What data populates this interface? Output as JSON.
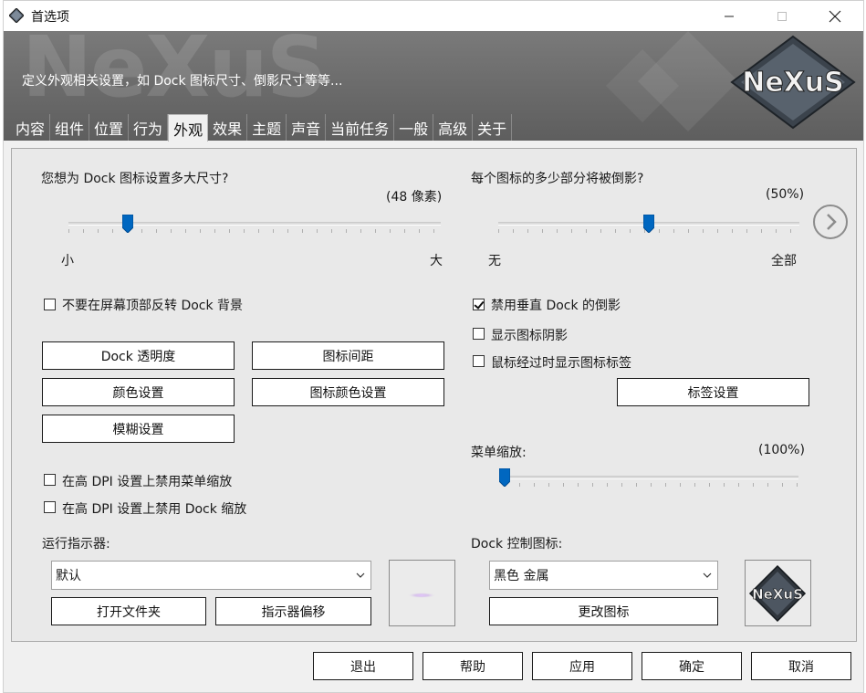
{
  "window": {
    "title": "首选项",
    "controls": {
      "minimize": "minimize",
      "maximize": "maximize",
      "close": "close"
    }
  },
  "banner": {
    "description": "定义外观相关设置，如 Dock 图标尺寸、倒影尺寸等等...",
    "logo_text": "NeXuS"
  },
  "tabs": [
    {
      "label": "内容",
      "active": false
    },
    {
      "label": "组件",
      "active": false
    },
    {
      "label": "位置",
      "active": false
    },
    {
      "label": "行为",
      "active": false
    },
    {
      "label": "外观",
      "active": true
    },
    {
      "label": "效果",
      "active": false
    },
    {
      "label": "主题",
      "active": false
    },
    {
      "label": "声音",
      "active": false
    },
    {
      "label": "当前任务",
      "active": false
    },
    {
      "label": "一般",
      "active": false
    },
    {
      "label": "高级",
      "active": false
    },
    {
      "label": "关于",
      "active": false
    }
  ],
  "icon_size": {
    "question": "您想为 Dock 图标设置多大尺寸?",
    "value_text": "(48 像素)",
    "slider_fraction": 0.16,
    "min_label": "小",
    "max_label": "大"
  },
  "reflection": {
    "question": "每个图标的多少部分将被倒影?",
    "value_text": "(50%)",
    "slider_fraction": 0.5,
    "min_label": "无",
    "max_label": "全部"
  },
  "left_checkbox": {
    "label": "不要在屏幕顶部反转 Dock 背景",
    "checked": false
  },
  "right_checkboxes": [
    {
      "label": "禁用垂直 Dock 的倒影",
      "checked": true
    },
    {
      "label": "显示图标阴影",
      "checked": false
    },
    {
      "label": "鼠标经过时显示图标标签",
      "checked": false
    }
  ],
  "buttons": {
    "dock_opacity": "Dock 透明度",
    "icon_spacing": "图标间距",
    "color_settings": "颜色设置",
    "icon_color_settings": "图标颜色设置",
    "blur_settings": "模糊设置",
    "label_settings": "标签设置",
    "open_folder": "打开文件夹",
    "indicator_offset": "指示器偏移",
    "change_icon": "更改图标"
  },
  "menu_zoom": {
    "label": "菜单缩放:",
    "value_text": "(100%)",
    "slider_fraction": 0.0
  },
  "dpi_checkboxes": [
    {
      "label": "在高 DPI 设置上禁用菜单缩放",
      "checked": false
    },
    {
      "label": "在高 DPI 设置上禁用 Dock 缩放",
      "checked": false
    }
  ],
  "run_indicator": {
    "label": "运行指示器:",
    "selected": "默认"
  },
  "dock_control_icon": {
    "label": "Dock 控制图标:",
    "selected": "黑色 金属",
    "icon_text": "NeXuS"
  },
  "footer": {
    "exit": "退出",
    "help": "帮助",
    "apply": "应用",
    "ok": "确定",
    "cancel": "取消"
  }
}
